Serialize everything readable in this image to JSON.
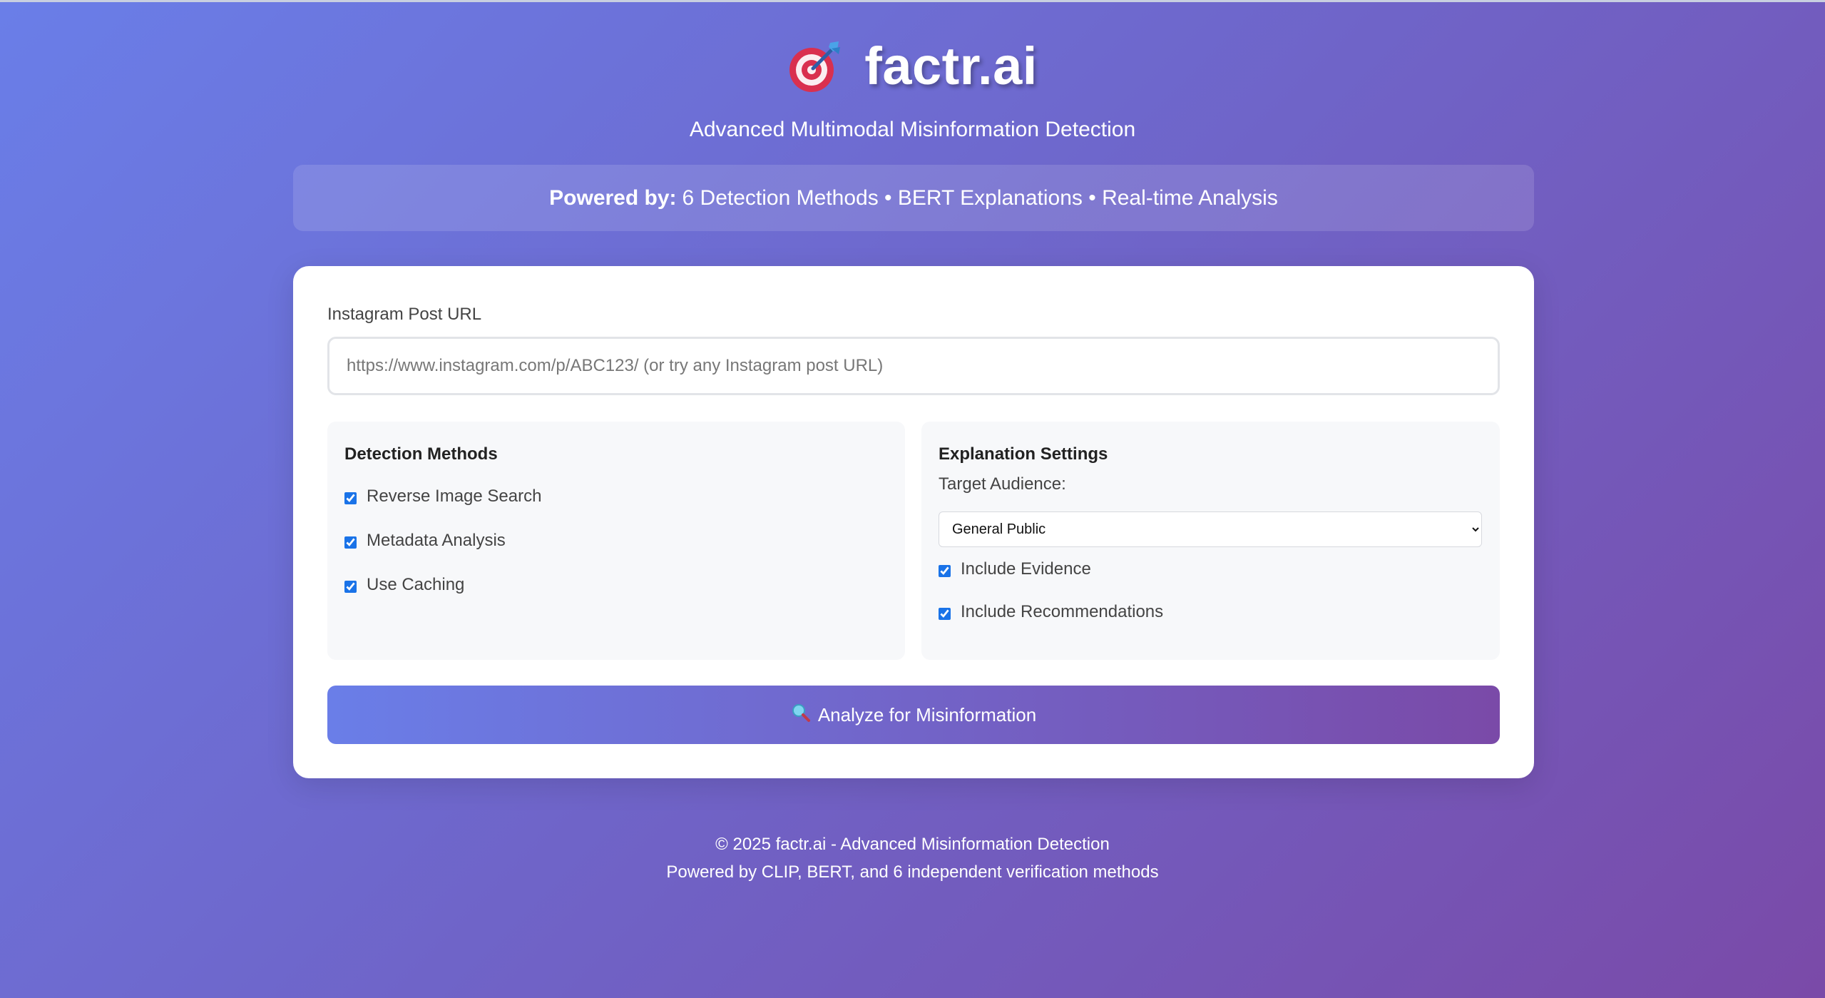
{
  "header": {
    "title": "factr.ai",
    "logo_icon": "target-dart-icon",
    "subtitle": "Advanced Multimodal Misinformation Detection"
  },
  "banner": {
    "lead": "Powered by:",
    "text": "6 Detection Methods • BERT Explanations • Real-time Analysis"
  },
  "form": {
    "url_label": "Instagram Post URL",
    "url_value": "",
    "url_placeholder": "https://www.instagram.com/p/ABC123/ (or try any Instagram post URL)",
    "detection": {
      "title": "Detection Methods",
      "options": [
        {
          "label": "Reverse Image Search",
          "checked": true
        },
        {
          "label": "Metadata Analysis",
          "checked": true
        },
        {
          "label": "Use Caching",
          "checked": true
        }
      ]
    },
    "explanation": {
      "title": "Explanation Settings",
      "audience_label": "Target Audience:",
      "audience_selected": "General Public",
      "options": [
        {
          "label": "Include Evidence",
          "checked": true
        },
        {
          "label": "Include Recommendations",
          "checked": true
        }
      ]
    },
    "submit_icon": "magnifier-icon",
    "submit_label": "Analyze for Misinformation"
  },
  "footer": {
    "line1": "© 2025 factr.ai - Advanced Misinformation Detection",
    "line2": "Powered by CLIP, BERT, and 6 independent verification methods"
  },
  "colors": {
    "bg_start": "#6a7ee8",
    "bg_end": "#7a4aa8",
    "card": "#ffffff",
    "panel": "#f7f8fa",
    "checkbox": "#1a73e8"
  }
}
